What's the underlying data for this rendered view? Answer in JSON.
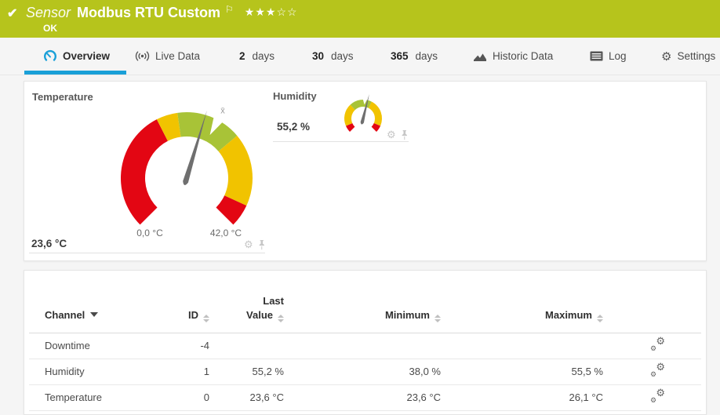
{
  "colors": {
    "status_ok_bg": "#b6c41c",
    "active_tab_accent": "#1aa0d8",
    "gauge_red": "#e30613",
    "gauge_yellow": "#f1c300",
    "gauge_green": "#a8c337"
  },
  "icons": {
    "check": "✔",
    "flag": "⚐",
    "gear": "⚙"
  },
  "header": {
    "kind": "Sensor",
    "title": "Modbus RTU Custom",
    "status": "OK",
    "stars_filled": "★★★",
    "stars_empty": "☆☆"
  },
  "tabs": [
    {
      "label": "Overview",
      "icon": "gauge-icon",
      "active": true
    },
    {
      "label": "Live Data",
      "icon": "broadcast-icon"
    },
    {
      "num": "2",
      "label": "days"
    },
    {
      "num": "30",
      "label": "days"
    },
    {
      "num": "365",
      "label": "days"
    },
    {
      "label": "Historic Data",
      "icon": "historic-data-icon"
    },
    {
      "label": "Log",
      "icon": "log-icon"
    },
    {
      "label": "Settings",
      "icon": "settings-icon"
    }
  ],
  "gauges": {
    "temperature": {
      "title": "Temperature",
      "current_value": "23,6 °C",
      "scale_min_label": "0,0 °C",
      "scale_max_label": "42,0 °C",
      "value": 23.6,
      "min": 0,
      "max": 42,
      "mean_marker": "x̄",
      "mean_frac": 0.605,
      "needle_color": "#6f6f6f",
      "segments": [
        {
          "to": 0.4,
          "color": "#e30613"
        },
        {
          "to": 0.47,
          "color": "#f1c300"
        },
        {
          "to": 0.685,
          "color": "#a8c337"
        },
        {
          "to": 0.925,
          "color": "#f1c300"
        },
        {
          "to": 1.0,
          "color": "#e30613"
        }
      ]
    },
    "humidity": {
      "title": "Humidity",
      "current_value": "55,2 %",
      "value": 55.2,
      "min": 0,
      "max": 100,
      "mean_frac": 0.52,
      "needle_color": "#6f6f6f",
      "segments": [
        {
          "to": 0.08,
          "color": "#e30613"
        },
        {
          "to": 0.34,
          "color": "#f1c300"
        },
        {
          "to": 0.6,
          "color": "#a8c337"
        },
        {
          "to": 0.92,
          "color": "#f1c300"
        },
        {
          "to": 1.0,
          "color": "#e30613"
        }
      ]
    }
  },
  "table": {
    "columns": [
      {
        "label": "Channel"
      },
      {
        "label": "ID"
      },
      {
        "label1": "Last",
        "label2": "Value"
      },
      {
        "label": "Minimum"
      },
      {
        "label": "Maximum"
      }
    ],
    "rows": [
      {
        "channel": "Downtime",
        "id": "-4",
        "last": "",
        "min": "",
        "max": ""
      },
      {
        "channel": "Humidity",
        "id": "1",
        "last": "55,2 %",
        "min": "38,0 %",
        "max": "55,5 %"
      },
      {
        "channel": "Temperature",
        "id": "0",
        "last": "23,6 °C",
        "min": "23,6 °C",
        "max": "26,1 °C"
      }
    ]
  }
}
